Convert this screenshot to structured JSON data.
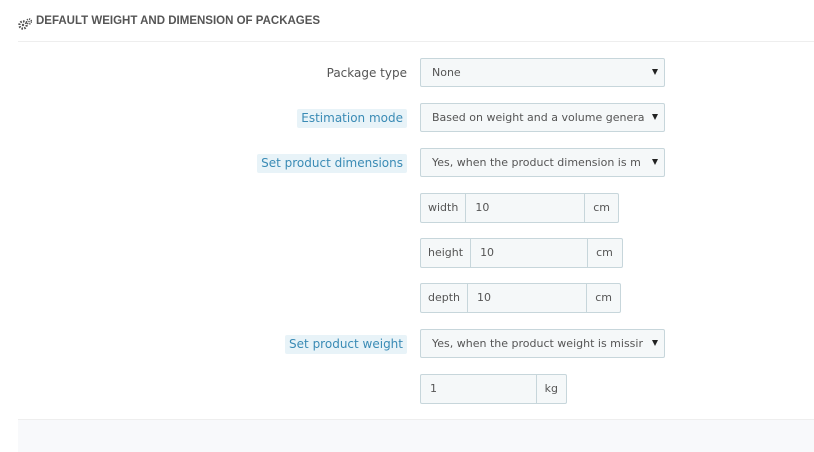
{
  "panel": {
    "title": "DEFAULT WEIGHT AND DIMENSION OF PACKAGES",
    "icon": "cogs-icon"
  },
  "form": {
    "package_type": {
      "label": "Package type",
      "value": "None"
    },
    "estimation_mode": {
      "label": "Estimation mode",
      "value": "Based on weight and a volume genera"
    },
    "set_product_dimensions": {
      "label": "Set product dimensions",
      "value": "Yes, when the product dimension is m"
    },
    "width": {
      "prefix": "width",
      "value": "10",
      "unit": "cm"
    },
    "height": {
      "prefix": "height",
      "value": "10",
      "unit": "cm"
    },
    "depth": {
      "prefix": "depth",
      "value": "10",
      "unit": "cm"
    },
    "set_product_weight": {
      "label": "Set product weight",
      "value": "Yes, when the product weight is missir"
    },
    "weight": {
      "value": "1",
      "unit": "kg"
    }
  },
  "colors": {
    "hint_bg": "#e8f3f8",
    "hint_text": "#3a8bb5",
    "input_bg": "#f5f8f9",
    "input_border": "#c7d6db"
  }
}
